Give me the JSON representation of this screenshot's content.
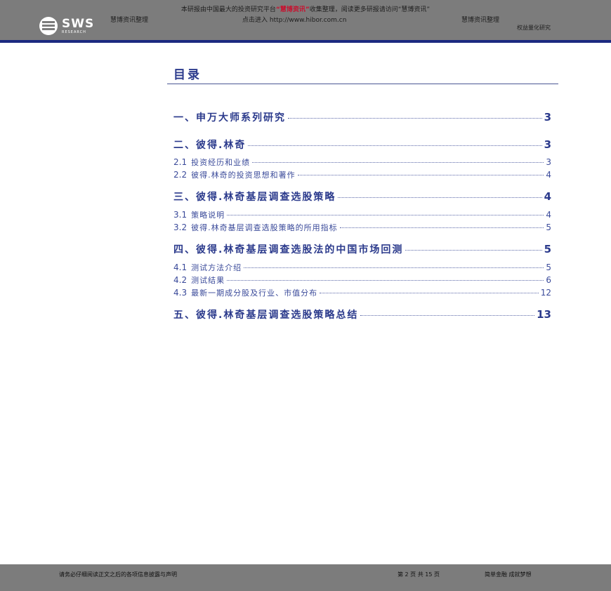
{
  "header": {
    "notice_prefix": "本研报由中国最大的投资研究平台",
    "notice_highlight": "“慧博资讯”",
    "notice_suffix": "收集整理，阅读更多研报请访问“慧博资讯”",
    "left_tag": "慧博资讯整理",
    "url_line": "点击进入 http://www.hibor.com.cn",
    "right_tag": "慧博资讯整理",
    "logo_text": "SWS",
    "logo_sub": "RESEARCH",
    "category": "权益量化研究"
  },
  "toc": {
    "title": "目录",
    "entries": [
      {
        "label": "一、申万大师系列研究",
        "page": "3"
      },
      {
        "label": "二、彼得.林奇",
        "page": "3"
      },
      {
        "section": "2.1",
        "label": "投资经历和业绩",
        "page": "3"
      },
      {
        "section": "2.2",
        "label": "彼得.林奇的投资思想和著作",
        "page": "4"
      },
      {
        "label": "三、彼得.林奇基层调查选股策略",
        "page": "4"
      },
      {
        "section": "3.1",
        "label": "策略说明",
        "page": "4"
      },
      {
        "section": "3.2",
        "label": "彼得.林奇基层调查选股策略的所用指标",
        "page": "5"
      },
      {
        "label": "四、彼得.林奇基层调查选股法的中国市场回测",
        "page": "5"
      },
      {
        "section": "4.1",
        "label": "测试方法介绍",
        "page": "5"
      },
      {
        "section": "4.2",
        "label": "测试结果",
        "page": "6"
      },
      {
        "section": "4.3",
        "label": "最新一期成分股及行业、市值分布",
        "page": "12"
      },
      {
        "label": "五、彼得.林奇基层调查选股策略总结",
        "page": "13"
      }
    ]
  },
  "footer": {
    "disclaimer": "请务必仔细阅读正文之后的各项信息披露与声明",
    "page_info": "第 2 页  共 15 页",
    "slogan": "简单金融 成就梦想"
  }
}
